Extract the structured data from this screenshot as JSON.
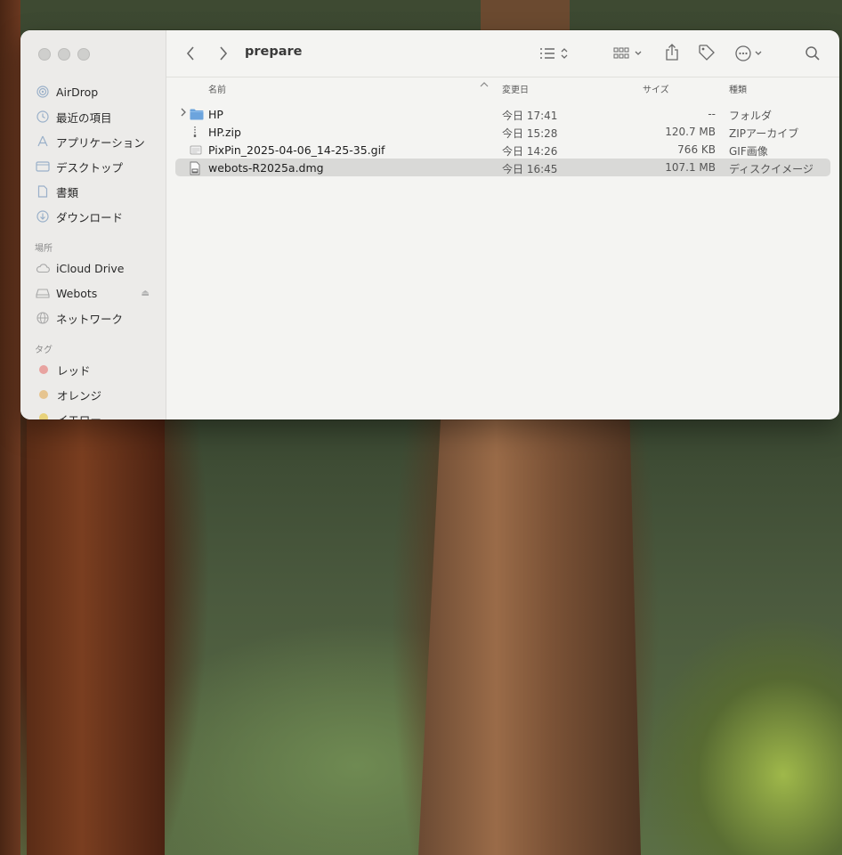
{
  "window": {
    "title": "prepare"
  },
  "sidebar": {
    "favorites": [
      {
        "label": "AirDrop",
        "icon": "airdrop-icon"
      },
      {
        "label": "最近の項目",
        "icon": "clock-icon"
      },
      {
        "label": "アプリケーション",
        "icon": "applications-icon"
      },
      {
        "label": "デスクトップ",
        "icon": "desktop-icon"
      },
      {
        "label": "書類",
        "icon": "document-icon"
      },
      {
        "label": "ダウンロード",
        "icon": "download-icon"
      }
    ],
    "locations_header": "場所",
    "locations": [
      {
        "label": "iCloud Drive",
        "icon": "cloud-icon"
      },
      {
        "label": "Webots",
        "icon": "disk-icon"
      },
      {
        "label": "ネットワーク",
        "icon": "network-icon"
      }
    ],
    "tags_header": "タグ",
    "tags": [
      {
        "label": "レッド",
        "color": "#e8a3a0"
      },
      {
        "label": "オレンジ",
        "color": "#e6c48f"
      },
      {
        "label": "イエロー",
        "color": "#e8d27a"
      }
    ]
  },
  "columns": {
    "name": "名前",
    "date": "変更日",
    "size": "サイズ",
    "kind": "種類"
  },
  "files": [
    {
      "name": "HP",
      "date": "今日 17:41",
      "size": "--",
      "kind": "フォルダ",
      "type": "folder"
    },
    {
      "name": "HP.zip",
      "date": "今日 15:28",
      "size": "120.7 MB",
      "kind": "ZIPアーカイブ",
      "type": "zip"
    },
    {
      "name": "PixPin_2025-04-06_14-25-35.gif",
      "date": "今日 14:26",
      "size": "766 KB",
      "kind": "GIF画像",
      "type": "gif"
    },
    {
      "name": "webots-R2025a.dmg",
      "date": "今日 16:45",
      "size": "107.1 MB",
      "kind": "ディスクイメージ",
      "type": "dmg",
      "selected": true
    }
  ]
}
